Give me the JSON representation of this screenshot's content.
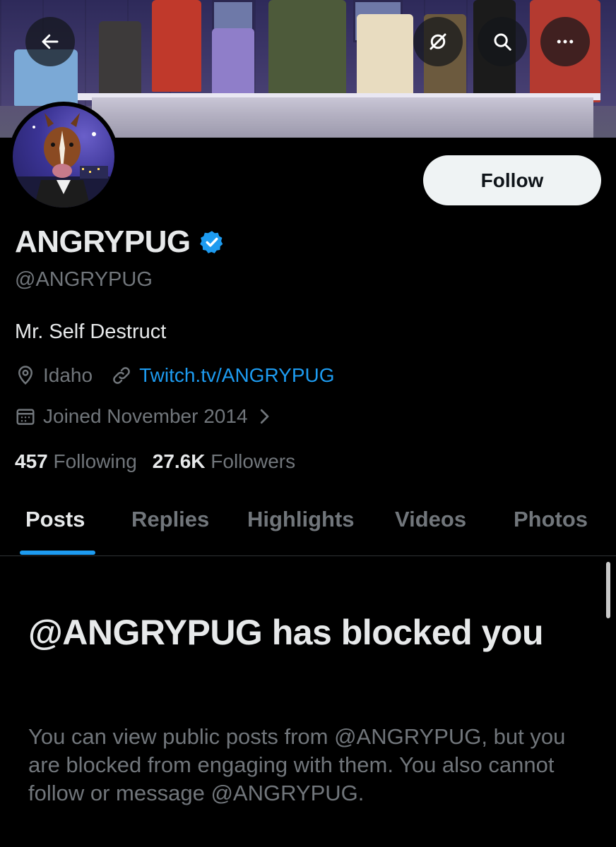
{
  "header": {
    "back_icon": "arrow-left-icon",
    "grok_icon": "grok-icon",
    "search_icon": "search-icon",
    "more_icon": "more-horizontal-icon"
  },
  "profile": {
    "display_name": "ANGRYPUG",
    "handle": "@ANGRYPUG",
    "verified": true,
    "bio": "Mr. Self Destruct",
    "location": "Idaho",
    "link": "Twitch.tv/ANGRYPUG",
    "joined": "Joined November 2014",
    "following_count": "457",
    "following_label": "Following",
    "followers_count": "27.6K",
    "followers_label": "Followers",
    "follow_label": "Follow"
  },
  "tabs": [
    {
      "label": "Posts",
      "active": true
    },
    {
      "label": "Replies",
      "active": false
    },
    {
      "label": "Highlights",
      "active": false
    },
    {
      "label": "Videos",
      "active": false
    },
    {
      "label": "Photos",
      "active": false
    }
  ],
  "blocked": {
    "title": "@ANGRYPUG has blocked you",
    "description": "You can view public posts from @ANGRYPUG, but you are blocked from engaging with them. You also cannot follow or message @ANGRYPUG."
  },
  "colors": {
    "background": "#000000",
    "accent": "#1d9bf0",
    "text_primary": "#e7e9ea",
    "text_secondary": "#71767b",
    "follow_button_bg": "#eff3f4"
  }
}
